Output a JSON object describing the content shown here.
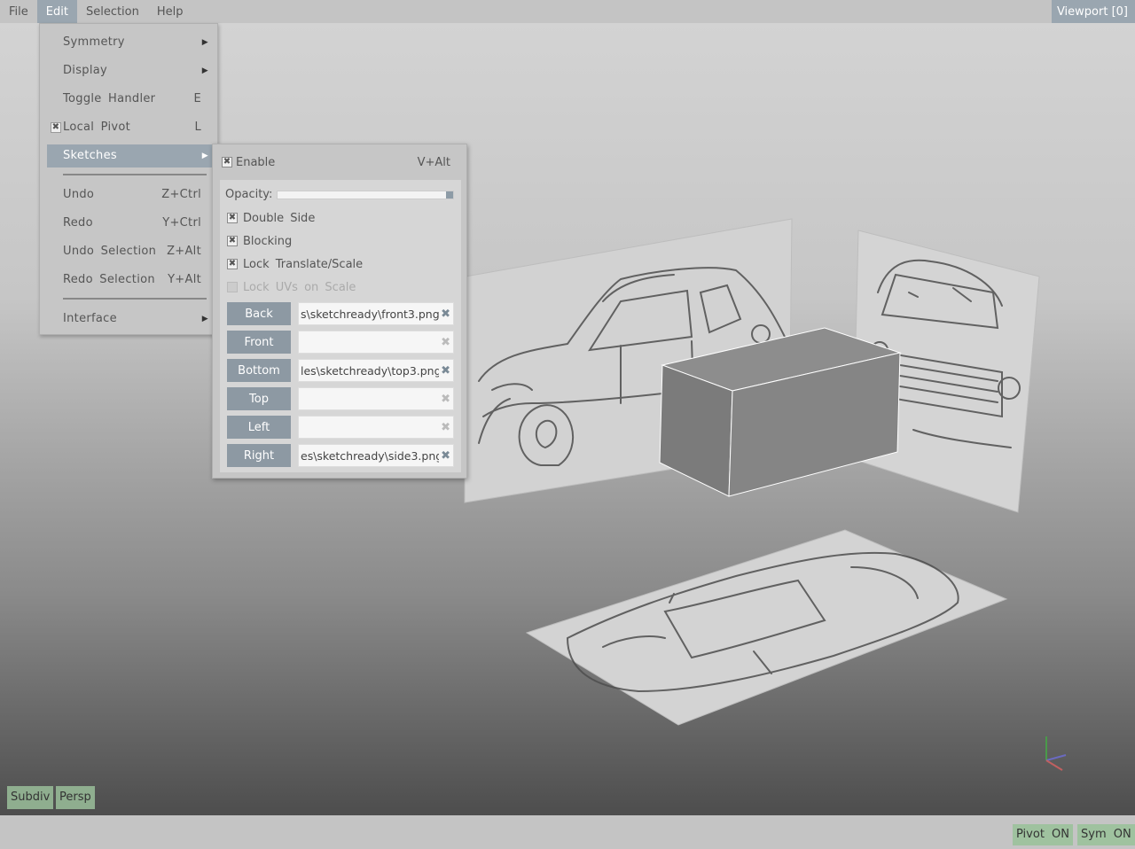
{
  "menubar": {
    "items": [
      {
        "label": "File"
      },
      {
        "label": "Edit"
      },
      {
        "label": "Selection"
      },
      {
        "label": "Help"
      }
    ],
    "viewport_label": "Viewport [0]"
  },
  "edit_menu": {
    "items": [
      {
        "label": "Symmetry",
        "shortcut": "",
        "submenu": true
      },
      {
        "label": "Display",
        "shortcut": "",
        "submenu": true
      },
      {
        "label": "Toggle Handler",
        "shortcut": "E"
      },
      {
        "label": "Local Pivot",
        "shortcut": "L",
        "checked": true
      },
      {
        "label": "Sketches",
        "shortcut": "",
        "submenu": true,
        "highlighted": true
      },
      {
        "label": "Undo",
        "shortcut": "Z+Ctrl"
      },
      {
        "label": "Redo",
        "shortcut": "Y+Ctrl"
      },
      {
        "label": "Undo Selection",
        "shortcut": "Z+Alt"
      },
      {
        "label": "Redo Selection",
        "shortcut": "Y+Alt"
      },
      {
        "label": "Interface",
        "shortcut": "",
        "submenu": true
      }
    ]
  },
  "sketches_menu": {
    "enable": {
      "label": "Enable",
      "shortcut": "V+Alt",
      "checked": true
    },
    "opacity": {
      "label": "Opacity:",
      "value": 1.0
    },
    "options": [
      {
        "label": "Double Side",
        "checked": true
      },
      {
        "label": "Blocking",
        "checked": true
      },
      {
        "label": "Lock Translate/Scale",
        "checked": true
      },
      {
        "label": "Lock UVs on Scale",
        "checked": false,
        "disabled": true
      }
    ],
    "images": [
      {
        "label": "Back",
        "file": "s\\sketchready\\front3.png"
      },
      {
        "label": "Front",
        "file": ""
      },
      {
        "label": "Bottom",
        "file": "les\\sketchready\\top3.png"
      },
      {
        "label": "Top",
        "file": ""
      },
      {
        "label": "Left",
        "file": ""
      },
      {
        "label": "Right",
        "file": "es\\sketchready\\side3.png"
      }
    ]
  },
  "viewport_buttons": {
    "subdiv": "Subdiv",
    "persp": "Persp"
  },
  "status": {
    "pivot": "Pivot ON",
    "sym": "Sym ON"
  },
  "icons": {
    "checkmark": "✖",
    "submenu_arrow": "▶",
    "clear": "✖"
  },
  "colors": {
    "highlight": "#9aa6b0",
    "toggle_on": "#9fc29f"
  }
}
